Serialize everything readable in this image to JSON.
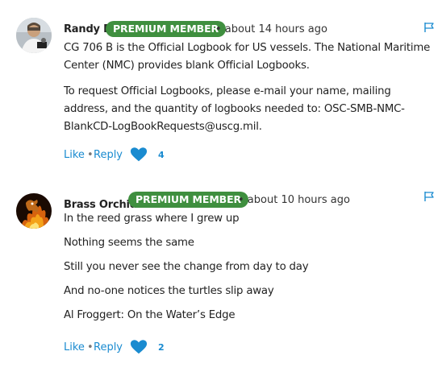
{
  "comments": [
    {
      "author": "Randy B",
      "badge": "PREMIUM MEMBER",
      "time": "• about 14 hours ago",
      "paragraphs": [
        "CG 706 B is the Official Logbook for US vessels. The National Maritime",
        "Center (NMC) provides blank Official Logbooks.",
        "To request Official Logbooks, please e-mail your name, mailing",
        "address, and the quantity of logbooks needed to: OSC-SMB-NMC-",
        "BlankCD-LogBookRequests@uscg.mil."
      ],
      "like_label": "Like",
      "separator": "•",
      "reply_label": "Reply",
      "like_count": "4"
    },
    {
      "author": "Brass Orchid",
      "badge": "PREMIUM MEMBER",
      "time": "• about 10 hours ago",
      "paragraphs": [
        "In the reed grass where I grew up",
        "Nothing seems the same",
        "Still you never see the change from day to day",
        "And no-one notices the turtles slip away",
        "Al Froggert: On the Water’s Edge"
      ],
      "like_label": "Like",
      "separator": "•",
      "reply_label": "Reply",
      "like_count": "2"
    }
  ],
  "colors": {
    "badge": "#3f8f3f",
    "link": "#1a8bd0",
    "flag": "#1a8bd0"
  },
  "icons": [
    "flag-icon",
    "heart-icon"
  ]
}
